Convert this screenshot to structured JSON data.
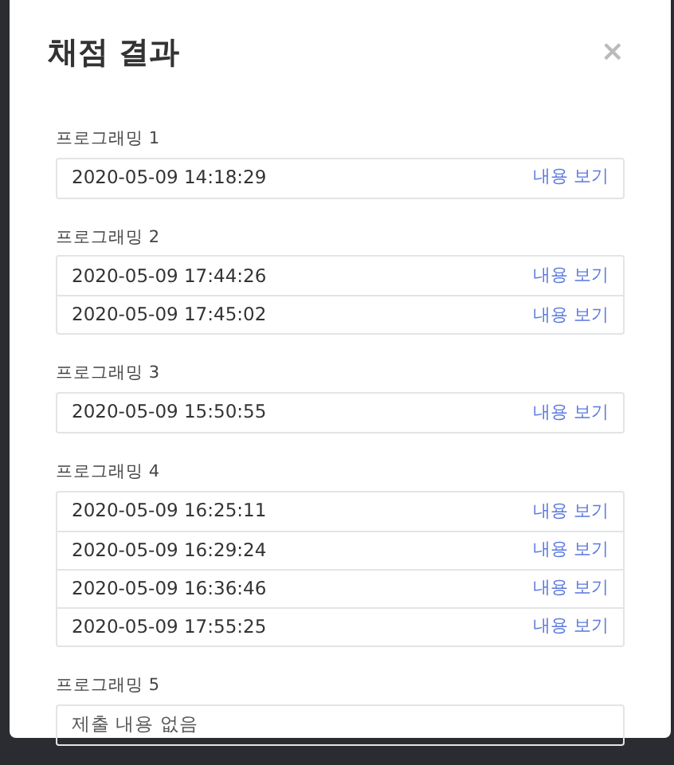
{
  "modal": {
    "title": "채점 결과",
    "close": "×"
  },
  "sections": [
    {
      "label": "프로그래밍 1",
      "entries": [
        {
          "kind": "submission",
          "time": "2020-05-09 14:18:29",
          "link": "내용 보기"
        }
      ]
    },
    {
      "label": "프로그래밍 2",
      "entries": [
        {
          "kind": "submission",
          "time": "2020-05-09 17:44:26",
          "link": "내용 보기"
        },
        {
          "kind": "submission",
          "time": "2020-05-09 17:45:02",
          "link": "내용 보기"
        }
      ]
    },
    {
      "label": "프로그래밍 3",
      "entries": [
        {
          "kind": "submission",
          "time": "2020-05-09 15:50:55",
          "link": "내용 보기"
        }
      ]
    },
    {
      "label": "프로그래밍 4",
      "entries": [
        {
          "kind": "submission",
          "time": "2020-05-09 16:25:11",
          "link": "내용 보기"
        },
        {
          "kind": "submission",
          "time": "2020-05-09 16:29:24",
          "link": "내용 보기"
        },
        {
          "kind": "submission",
          "time": "2020-05-09 16:36:46",
          "link": "내용 보기"
        },
        {
          "kind": "submission",
          "time": "2020-05-09 17:55:25",
          "link": "내용 보기"
        }
      ]
    },
    {
      "label": "프로그래밍 5",
      "entries": [
        {
          "kind": "empty",
          "text": "제출 내용 없음"
        }
      ]
    }
  ]
}
